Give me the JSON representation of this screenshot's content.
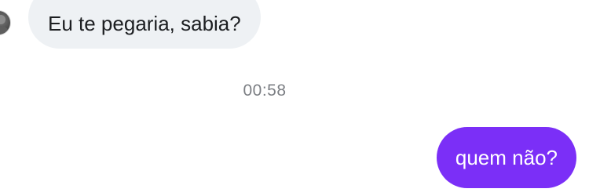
{
  "conversation": {
    "incoming": {
      "text": "Eu te pegaria, sabia?"
    },
    "timestamp": "00:58",
    "outgoing": {
      "text": "quem não?"
    }
  },
  "colors": {
    "incoming_bubble": "#eef1f4",
    "outgoing_bubble": "#7b2ff7",
    "timestamp_text": "#7b7e83"
  }
}
